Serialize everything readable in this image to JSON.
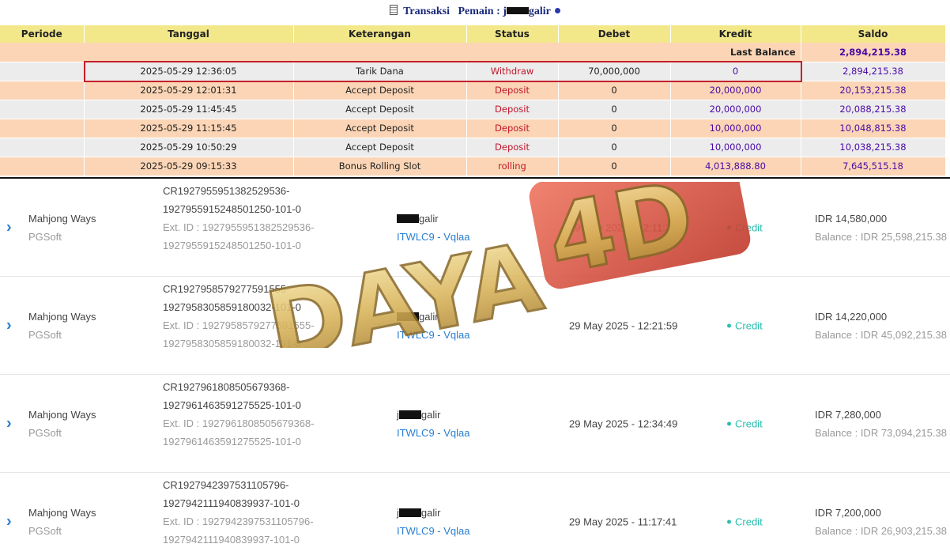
{
  "header": {
    "title_prefix": "Transaksi",
    "player_label": "Pemain :",
    "player_initial": "j",
    "player_suffix": "galir"
  },
  "table": {
    "columns": [
      "Periode",
      "Tanggal",
      "Keterangan",
      "Status",
      "Debet",
      "Kredit",
      "Saldo"
    ],
    "last_balance_label": "Last Balance",
    "last_balance_value": "2,894,215.38",
    "rows": [
      {
        "tanggal": "2025-05-29 12:36:05",
        "keterangan": "Tarik Dana",
        "status": "Withdraw",
        "debet": "70,000,000",
        "kredit": "0",
        "saldo": "2,894,215.38"
      },
      {
        "tanggal": "2025-05-29 12:01:31",
        "keterangan": "Accept Deposit",
        "status": "Deposit",
        "debet": "0",
        "kredit": "20,000,000",
        "saldo": "20,153,215.38"
      },
      {
        "tanggal": "2025-05-29 11:45:45",
        "keterangan": "Accept Deposit",
        "status": "Deposit",
        "debet": "0",
        "kredit": "20,000,000",
        "saldo": "20,088,215.38"
      },
      {
        "tanggal": "2025-05-29 11:15:45",
        "keterangan": "Accept Deposit",
        "status": "Deposit",
        "debet": "0",
        "kredit": "10,000,000",
        "saldo": "10,048,815.38"
      },
      {
        "tanggal": "2025-05-29 10:50:29",
        "keterangan": "Accept Deposit",
        "status": "Deposit",
        "debet": "0",
        "kredit": "10,000,000",
        "saldo": "10,038,215.38"
      },
      {
        "tanggal": "2025-05-29 09:15:33",
        "keterangan": "Bonus Rolling Slot",
        "status": "rolling",
        "debet": "0",
        "kredit": "4,013,888.80",
        "saldo": "7,645,515.18"
      }
    ]
  },
  "bets": [
    {
      "game": "Mahjong Ways",
      "provider": "PGSoft",
      "id_line1": "CR1927955951382529536-",
      "id_line2": "1927955915248501250-101-0",
      "ext_line1": "Ext. ID : 1927955951382529536-",
      "ext_line2": "1927955915248501250-101-0",
      "player_initial": "",
      "player_suffix": "galir",
      "agent": "ITWLC9 - Vqlaa",
      "date": "29 May 2025 - 12:11:33",
      "type": "Credit",
      "amount": "IDR 14,580,000",
      "balance": "Balance : IDR 25,598,215.38"
    },
    {
      "game": "Mahjong Ways",
      "provider": "PGSoft",
      "id_line1": "CR1927958579277591555-",
      "id_line2": "1927958305859180032-101-0",
      "ext_line1": "Ext. ID : 1927958579277591555-",
      "ext_line2": "1927958305859180032-101-0",
      "player_initial": "",
      "player_suffix": "galir",
      "agent": "ITWLC9 - Vqlaa",
      "date": "29 May 2025 - 12:21:59",
      "type": "Credit",
      "amount": "IDR 14,220,000",
      "balance": "Balance : IDR 45,092,215.38"
    },
    {
      "game": "Mahjong Ways",
      "provider": "PGSoft",
      "id_line1": "CR1927961808505679368-",
      "id_line2": "1927961463591275525-101-0",
      "ext_line1": "Ext. ID : 1927961808505679368-",
      "ext_line2": "1927961463591275525-101-0",
      "player_initial": "j",
      "player_suffix": "galir",
      "agent": "ITWLC9 - Vqlaa",
      "date": "29 May 2025 - 12:34:49",
      "type": "Credit",
      "amount": "IDR 7,280,000",
      "balance": "Balance : IDR 73,094,215.38"
    },
    {
      "game": "Mahjong Ways",
      "provider": "PGSoft",
      "id_line1": "CR1927942397531105796-",
      "id_line2": "1927942111940839937-101-0",
      "ext_line1": "Ext. ID : 1927942397531105796-",
      "ext_line2": "1927942111940839937-101-0",
      "player_initial": "j",
      "player_suffix": "galir",
      "agent": "ITWLC9 - Vqlaa",
      "date": "29 May 2025 - 11:17:41",
      "type": "Credit",
      "amount": "IDR 7,200,000",
      "balance": "Balance : IDR 26,903,215.38"
    }
  ],
  "watermark": {
    "text": "DAYA",
    "badge": "4D"
  },
  "colors": {
    "header_bg": "#f2e88a",
    "peach_row": "#fbd5b5",
    "grey_row": "#ececec",
    "status_red": "#c0162a",
    "kredit_purple": "#4a0aa8",
    "highlight_border": "#c4202a",
    "link_blue": "#2a7fd0",
    "credit_teal": "#2abfb0"
  },
  "icons": [
    "document-icon",
    "info-icon",
    "chevron-right-icon"
  ]
}
